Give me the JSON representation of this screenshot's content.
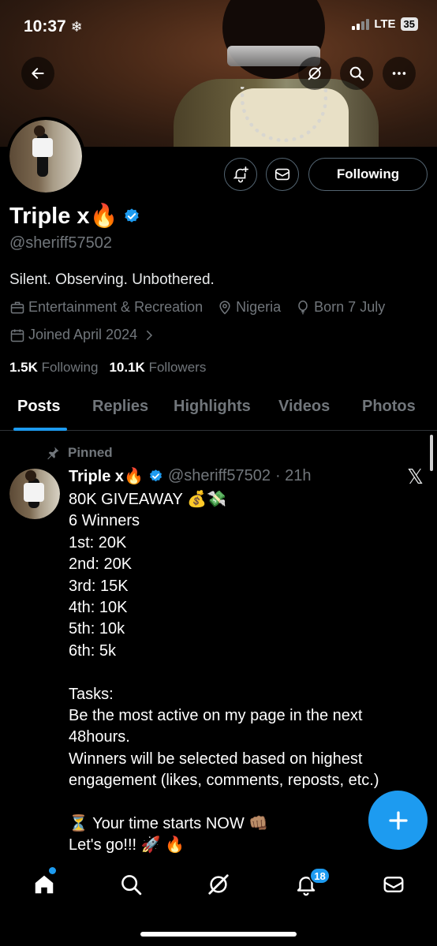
{
  "status_bar": {
    "time": "10:37",
    "network": "LTE",
    "battery": "35"
  },
  "profile": {
    "name": "Triple x🔥",
    "handle": "@sheriff57502",
    "bio": "Silent. Observing. Unbothered.",
    "category": "Entertainment & Recreation",
    "location": "Nigeria",
    "born": "Born 7 July",
    "joined": "Joined April 2024",
    "following_count": "1.5K",
    "following_label": "Following",
    "followers_count": "10.1K",
    "followers_label": "Followers",
    "follow_button": "Following"
  },
  "tabs": [
    "Posts",
    "Replies",
    "Highlights",
    "Videos",
    "Photos"
  ],
  "active_tab": "Posts",
  "pinned_post": {
    "pinned_label": "Pinned",
    "author": "Triple x🔥",
    "handle": "@sheriff57502",
    "time": "· 21h",
    "lines": [
      "80K GIVEAWAY 💰💸",
      "6 Winners",
      "1st: 20K",
      "2nd: 20K",
      "3rd: 15K",
      "4th: 10K",
      "5th: 10k",
      "6th: 5k",
      "",
      "Tasks:",
      "Be the most active on my page in the next",
      "48hours.",
      "Winners will be selected based on highest",
      "engagement (likes, comments, reposts, etc.)",
      "",
      "⏳ Your time starts NOW 👊🏽",
      "Let's go!!! 🚀 🔥"
    ]
  },
  "notifications_badge": "18",
  "colors": {
    "accent": "#1d9bf0",
    "background": "#000000",
    "muted": "#71767b"
  },
  "icons": [
    "back-arrow-icon",
    "grok-icon",
    "search-icon",
    "more-icon",
    "notification-add-icon",
    "message-icon",
    "verified-icon",
    "briefcase-icon",
    "location-icon",
    "balloon-icon",
    "calendar-icon",
    "chevron-right-icon",
    "pin-icon",
    "x-logo-icon",
    "plus-icon",
    "home-icon",
    "notifications-icon",
    "mail-icon"
  ]
}
